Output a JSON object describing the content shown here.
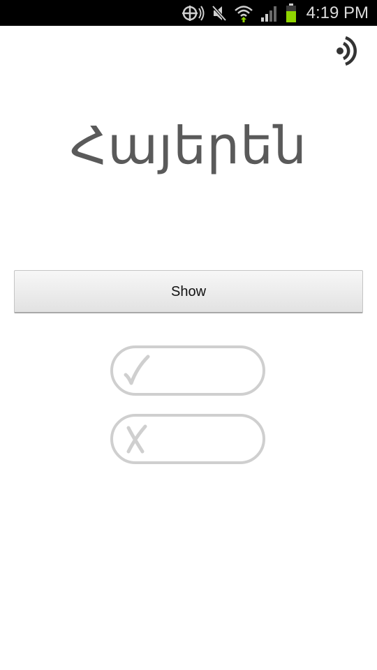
{
  "status_bar": {
    "time": "4:19 PM",
    "icons": [
      "gps-icon",
      "mute-icon",
      "wifi-icon",
      "signal-icon",
      "battery-icon"
    ],
    "colors": {
      "battery": "#8fd400",
      "wifi_arrow": "#8fd400"
    }
  },
  "main": {
    "word": "Հայերեն",
    "show_label": "Show",
    "sound_icon": "sound-icon",
    "correct_icon": "check-icon",
    "wrong_icon": "cross-icon"
  }
}
